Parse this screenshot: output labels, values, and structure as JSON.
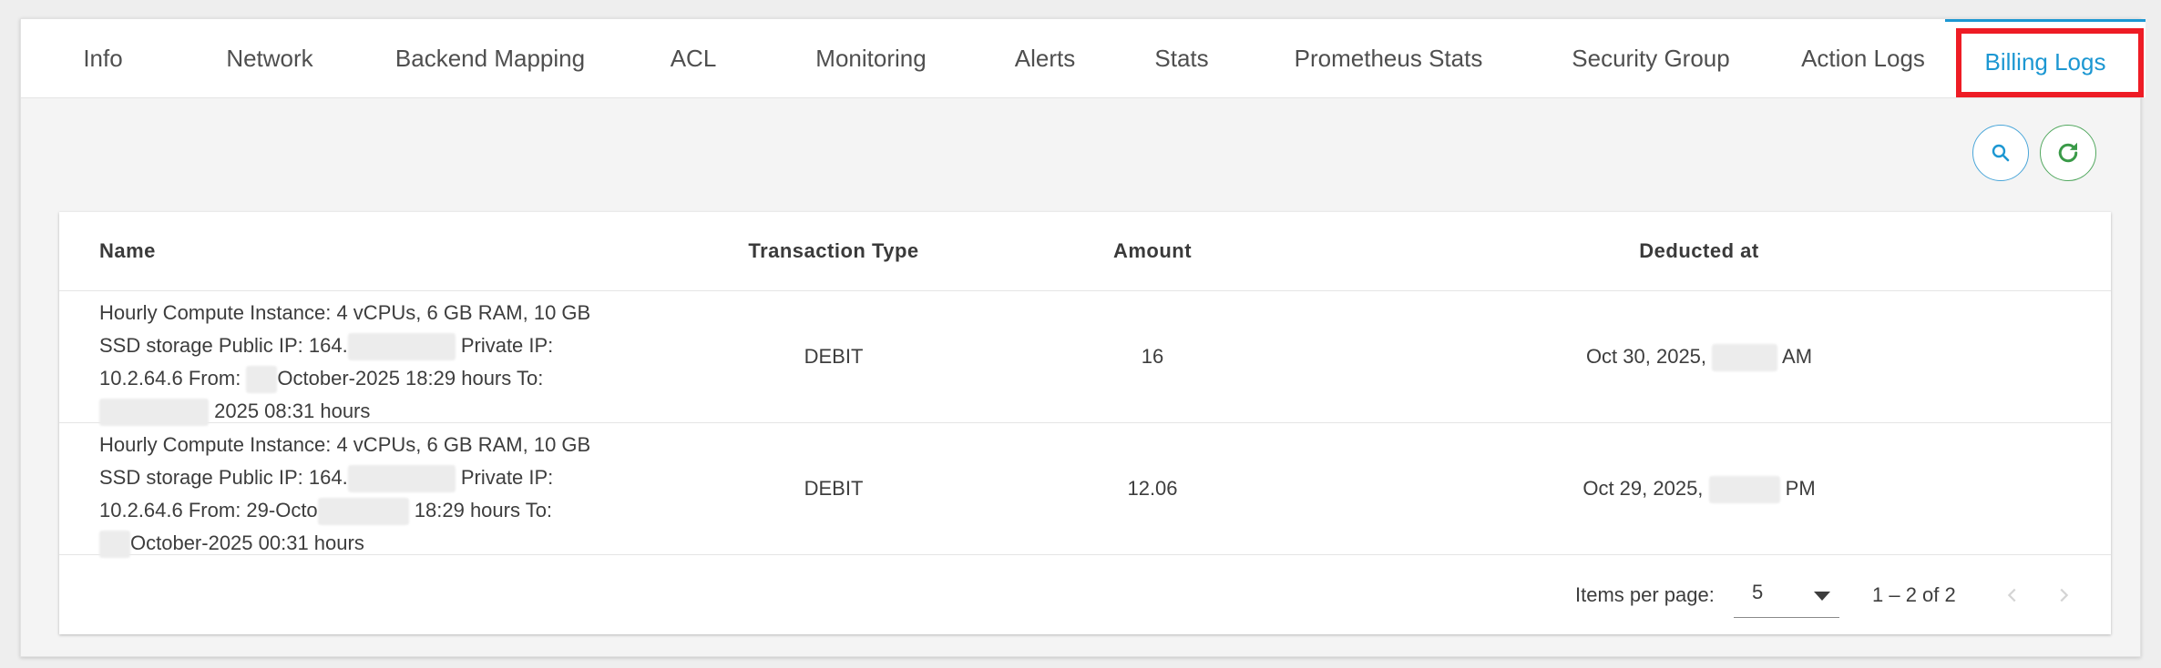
{
  "tabs": [
    {
      "label": "Info"
    },
    {
      "label": "Network"
    },
    {
      "label": "Backend Mapping"
    },
    {
      "label": "ACL"
    },
    {
      "label": "Monitoring"
    },
    {
      "label": "Alerts"
    },
    {
      "label": "Stats"
    },
    {
      "label": "Prometheus Stats"
    },
    {
      "label": "Security Group"
    },
    {
      "label": "Action Logs"
    },
    {
      "label": "Billing Logs",
      "active": true
    }
  ],
  "toolbar": {
    "search_icon": "search-icon",
    "refresh_icon": "refresh-icon"
  },
  "table": {
    "columns": {
      "name": "Name",
      "transaction_type": "Transaction Type",
      "amount": "Amount",
      "deducted_at": "Deducted at"
    },
    "rows": [
      {
        "name_line1": "Hourly Compute Instance: 4 vCPUs, 6 GB RAM, 10 GB",
        "name_line2a": "SSD storage Public IP: 164.",
        "name_line2b": " Private IP:",
        "name_line3a": "10.2.64.6 From: ",
        "name_line3b": "October-2025 18:29 hours To:",
        "name_line4b": "2025 08:31 hours",
        "transaction_type": "DEBIT",
        "amount": "16",
        "deducted_a": "Oct 30, 2025, ",
        "deducted_b": " AM"
      },
      {
        "name_line1": "Hourly Compute Instance: 4 vCPUs, 6 GB RAM, 10 GB",
        "name_line2a": "SSD storage Public IP: 164.",
        "name_line2b": " Private IP:",
        "name_line3a": "10.2.64.6 From: 29-Octo",
        "name_line3b": " 18:29 hours To:",
        "name_line4b": "October-2025 00:31 hours",
        "transaction_type": "DEBIT",
        "amount": "12.06",
        "deducted_a": "Oct 29, 2025, ",
        "deducted_b": " PM"
      }
    ]
  },
  "paginator": {
    "items_per_page_label": "Items per page:",
    "page_size": "5",
    "range_label": "1 – 2 of 2"
  },
  "colors": {
    "accent": "#1c97d2",
    "highlight": "#ee1c25",
    "refresh": "#52a85f"
  }
}
